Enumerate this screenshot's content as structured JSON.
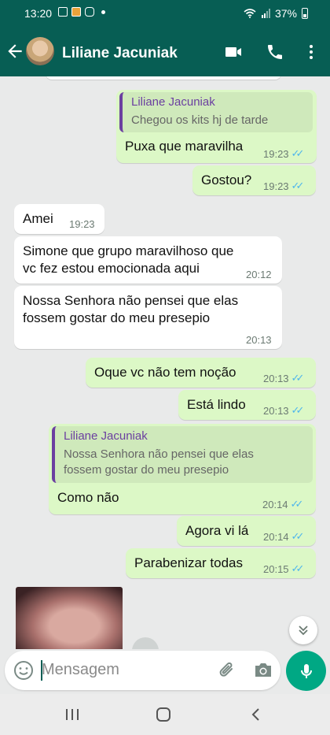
{
  "status_bar": {
    "time": "13:20",
    "battery": "37%"
  },
  "header": {
    "contact_name": "Liliane Jacuniak"
  },
  "messages": [
    {
      "dir": "out",
      "quote": {
        "name": "Liliane Jacuniak",
        "text": "Chegou os kits hj de tarde"
      },
      "text": "Puxa que maravilha",
      "time": "19:23",
      "ticks": "✓✓"
    },
    {
      "dir": "out",
      "text": "Gostou?",
      "time": "19:23",
      "ticks": "✓✓"
    },
    {
      "dir": "in",
      "text": "Amei",
      "time": "19:23"
    },
    {
      "dir": "in",
      "text_lines": [
        "Simone que grupo maravilhoso que",
        "vc fez estou emocionada aqui"
      ],
      "time": "20:12"
    },
    {
      "dir": "in",
      "text_lines": [
        "Nossa Senhora não pensei que elas",
        "fossem gostar do meu presepio"
      ],
      "time": "20:13"
    },
    {
      "dir": "out",
      "text": "Oque vc não  tem noção",
      "time": "20:13",
      "ticks": "✓✓"
    },
    {
      "dir": "out",
      "text": "Está  lindo",
      "time": "20:13",
      "ticks": "✓✓"
    },
    {
      "dir": "out",
      "quote": {
        "name": "Liliane Jacuniak",
        "text_lines": [
          "Nossa Senhora não pensei que elas",
          "fossem gostar do meu presepio"
        ]
      },
      "text": "Como não",
      "time": "20:14",
      "ticks": "✓✓"
    },
    {
      "dir": "out",
      "text": "Agora vi lá",
      "time": "20:14",
      "ticks": "✓✓"
    },
    {
      "dir": "out",
      "text": "Parabenizar todas",
      "time": "20:15",
      "ticks": "✓✓"
    }
  ],
  "composer": {
    "placeholder": "Mensagem"
  },
  "colors": {
    "header": "#075e54",
    "outgoing": "#dcf8c6",
    "incoming": "#ffffff",
    "accent": "#00a884",
    "read_ticks": "#4fb6ec"
  }
}
